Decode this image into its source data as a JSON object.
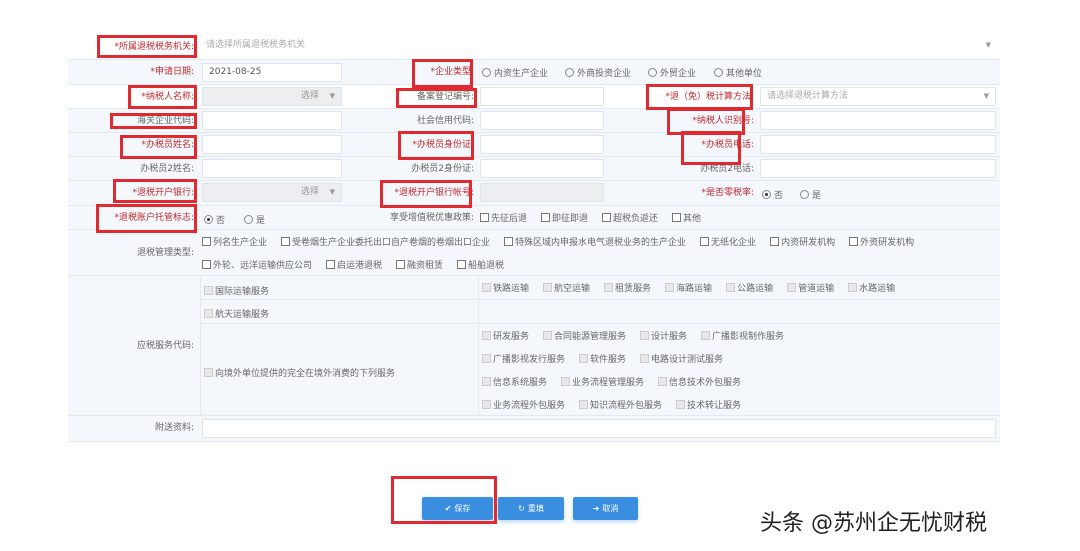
{
  "form": {
    "tax_authority": {
      "label": "*所属退税税务机关:",
      "placeholder": "请选择所属退税税务机关"
    },
    "apply_date": {
      "label": "*申请日期:",
      "value": "2021-08-25"
    },
    "enterprise_type": {
      "label": "*企业类型:",
      "options": [
        "内资生产企业",
        "外商投资企业",
        "外贸企业",
        "其他单位"
      ]
    },
    "taxpayer_name": {
      "label": "*纳税人名称:",
      "select_label": "选择"
    },
    "record_no": {
      "label": "备案登记编号:"
    },
    "calc_method": {
      "label": "*退（免）税计算方法:",
      "placeholder": "请选择退税计算方法"
    },
    "customs_code": {
      "label": "海关企业代码:"
    },
    "credit_code": {
      "label": "社会信用代码:"
    },
    "taxpayer_id": {
      "label": "*纳税人识别号:"
    },
    "agent_name": {
      "label": "*办税员姓名:"
    },
    "agent_id": {
      "label": "*办税员身份证:"
    },
    "agent_phone": {
      "label": "*办税员电话:"
    },
    "agent2_name": {
      "label": "办税员2姓名:"
    },
    "agent2_id": {
      "label": "办税员2身份证:"
    },
    "agent2_phone": {
      "label": "办税员2电话:"
    },
    "bank": {
      "label": "*退税开户银行:",
      "select_label": "选择"
    },
    "bank_account": {
      "label": "*退税开户银行帐号:"
    },
    "zero_rate": {
      "label": "*是否零税率:",
      "options": [
        "否",
        "是"
      ],
      "selected": "否"
    },
    "custody_flag": {
      "label": "*退税账户托管标志:",
      "options": [
        "否",
        "是"
      ],
      "selected": "否"
    },
    "vat_policy": {
      "label": "享受增值税优惠政策:",
      "options": [
        "先征后退",
        "即征即退",
        "超税负返还",
        "其他"
      ]
    },
    "mgmt_type": {
      "label": "退税管理类型:",
      "options": [
        "列名生产企业",
        "受卷烟生产企业委托出口自产卷烟的卷烟出口企业",
        "特殊区域内申报水电气退税业务的生产企业",
        "无纸化企业",
        "内资研发机构",
        "外资研发机构",
        "外轮、远洋运输供应公司",
        "启运港退税",
        "融资租赁",
        "船舶退税"
      ]
    },
    "service_code": {
      "label": "应税服务代码:",
      "intl_transport": "国际运输服务",
      "transport_items": [
        "铁路运输",
        "航空运输",
        "租赁服务",
        "海路运输",
        "公路运输",
        "管道运输",
        "水路运输"
      ],
      "aerospace": "航天运输服务",
      "overseas": "向境外单位提供的完全在境外消费的下列服务",
      "overseas_items": [
        "研发服务",
        "合同能源管理服务",
        "设计服务",
        "广播影视制作服务",
        "广播影视发行服务",
        "软件服务",
        "电路设计测试服务",
        "信息系统服务",
        "业务流程管理服务",
        "信息技术外包服务",
        "业务流程外包服务",
        "知识流程外包服务",
        "技术转让服务"
      ]
    },
    "attachments": {
      "label": "附送资料:"
    }
  },
  "buttons": {
    "save": "保存",
    "reset": "重填",
    "cancel": "取消"
  },
  "watermark": "头条 @苏州企无忧财税",
  "colors": {
    "accent": "#3a8ee0",
    "required": "#c0282e",
    "highlight": "#e02a2f"
  }
}
